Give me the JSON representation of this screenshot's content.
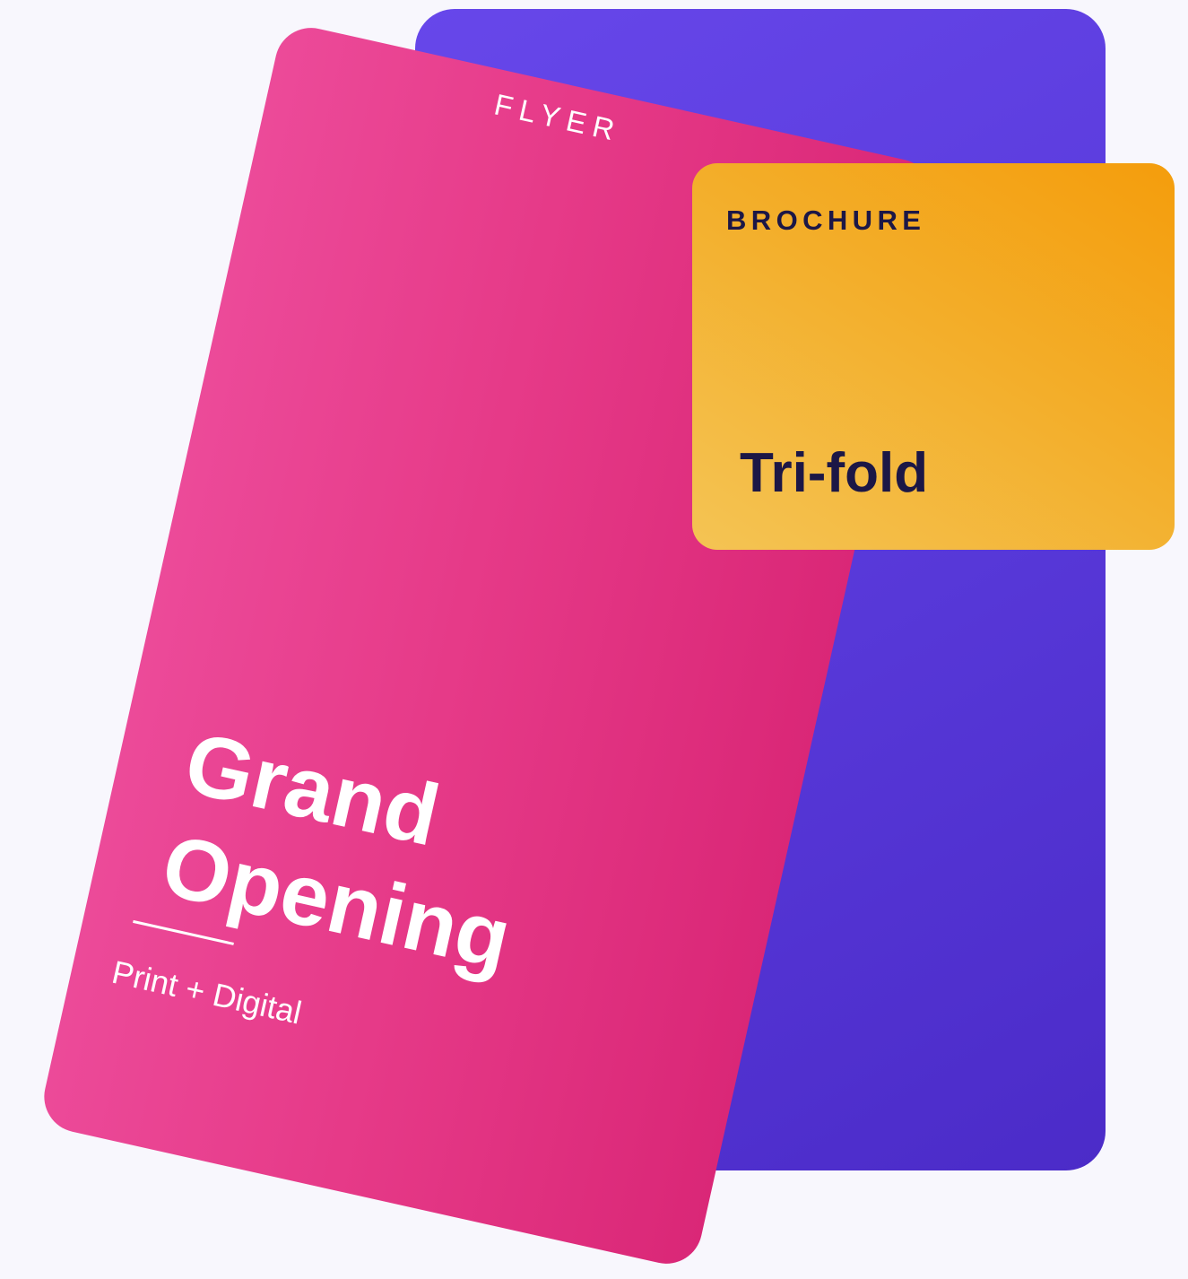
{
  "flyer": {
    "tag": "FLYER",
    "title_line1": "Grand",
    "title_line2": "Opening",
    "subtitle": "Print + Digital"
  },
  "brochure": {
    "tag": "BROCHURE",
    "title": "Tri-fold"
  },
  "colors": {
    "background": "#f8f7fd",
    "back_card": "#5a3bdc",
    "flyer_card": "#e63a88",
    "brochure_card": "#f3ae2a",
    "brochure_text": "#1c1746"
  }
}
